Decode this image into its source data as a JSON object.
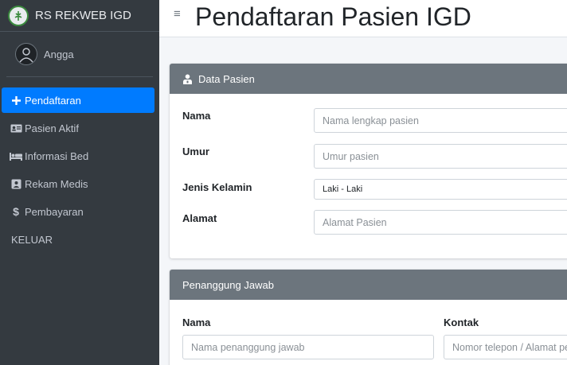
{
  "brand": {
    "title": "RS REKWEB IGD",
    "logo_icon": "hospital-logo-icon"
  },
  "user": {
    "name": "Angga"
  },
  "sidebar": {
    "items": [
      {
        "label": "Pendaftaran",
        "icon": "plus-icon",
        "active": true
      },
      {
        "label": "Pasien Aktif",
        "icon": "id-card-icon"
      },
      {
        "label": "Informasi Bed",
        "icon": "bed-icon"
      },
      {
        "label": "Rekam Medis",
        "icon": "medical-file-icon"
      },
      {
        "label": "Pembayaran",
        "icon": "dollar-icon"
      },
      {
        "label": "KELUAR"
      }
    ]
  },
  "header": {
    "title": "Pendaftaran Pasien IGD"
  },
  "data_pasien": {
    "title": "Data Pasien",
    "nama_label": "Nama",
    "nama_placeholder": "Nama lengkap pasien",
    "umur_label": "Umur",
    "umur_placeholder": "Umur pasien",
    "jk_label": "Jenis Kelamin",
    "jk_value": "Laki - Laki",
    "alamat_label": "Alamat",
    "alamat_placeholder": "Alamat Pasien"
  },
  "penanggung": {
    "title": "Penanggung Jawab",
    "nama_label": "Nama",
    "nama_placeholder": "Nama penanggung jawab",
    "kontak_label": "Kontak",
    "kontak_placeholder": "Nomor telepon / Alamat pe"
  },
  "colors": {
    "sidebar": "#343a40",
    "active": "#007bff",
    "card_header": "#6c757d"
  }
}
